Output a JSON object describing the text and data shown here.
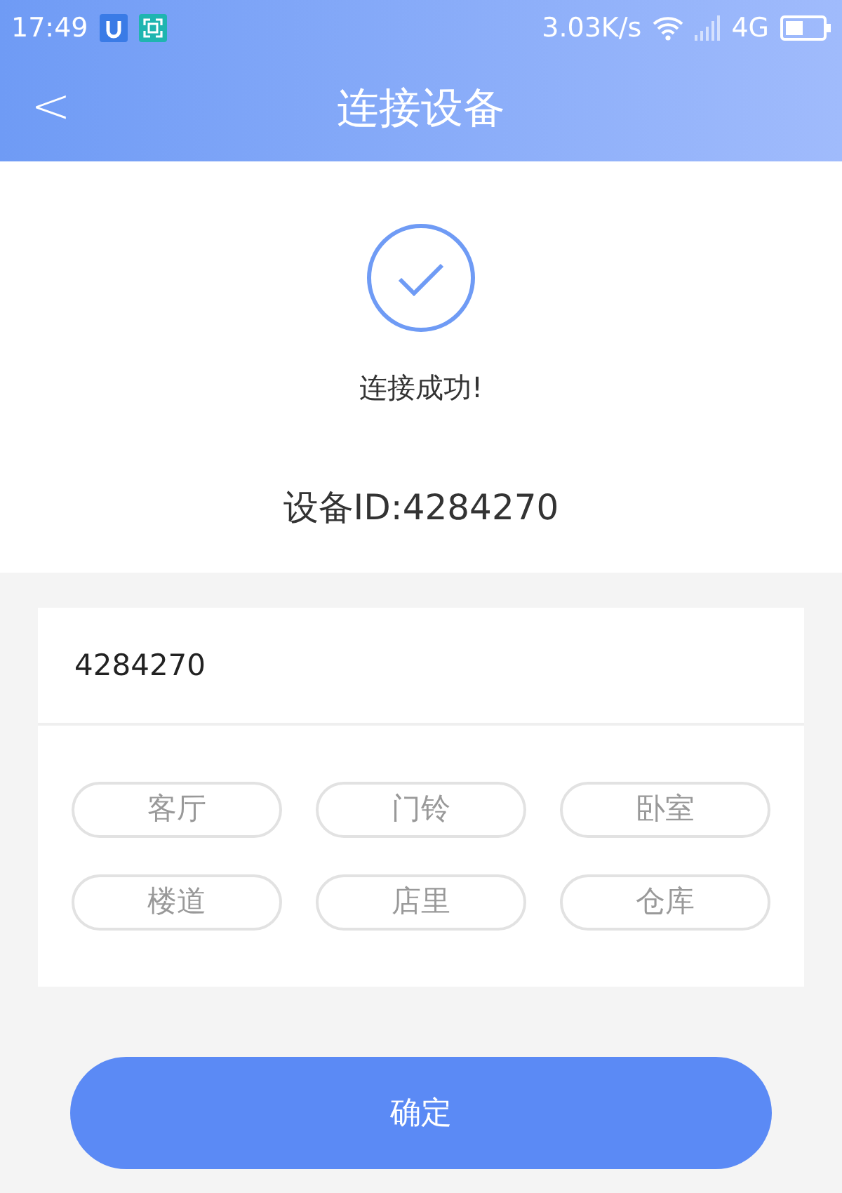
{
  "status_bar": {
    "time": "17:49",
    "speed": "3.03K/s",
    "network": "4G"
  },
  "header": {
    "back": "<",
    "title": "连接设备"
  },
  "result": {
    "message": "连接成功!",
    "device_id": "设备ID:4284270"
  },
  "name_field": {
    "value": "4284270"
  },
  "tags": [
    {
      "label": "客厅"
    },
    {
      "label": "门铃"
    },
    {
      "label": "卧室"
    },
    {
      "label": "楼道"
    },
    {
      "label": "店里"
    },
    {
      "label": "仓库"
    }
  ],
  "confirm_button": "确定"
}
